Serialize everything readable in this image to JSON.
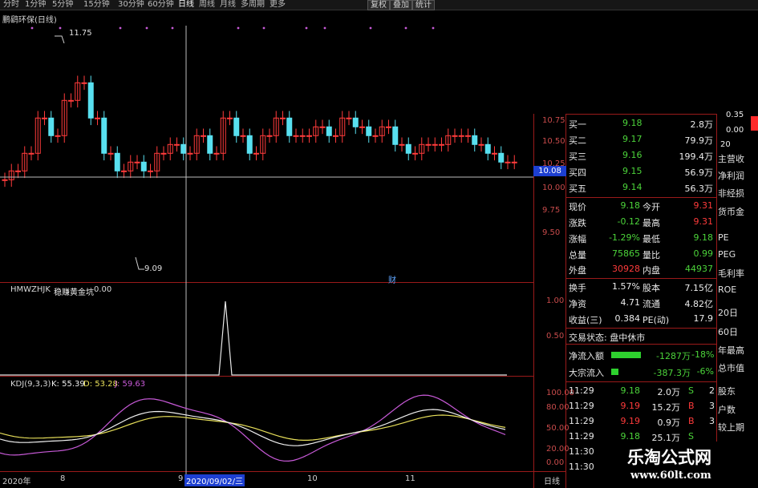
{
  "toolbar": {
    "periods": [
      "分时",
      "1分钟",
      "5分钟",
      "15分钟",
      "30分钟",
      "60分钟",
      "日线",
      "周线",
      "月线",
      "多周期",
      "更多"
    ],
    "buttons": [
      "复权",
      "叠加",
      "统计"
    ]
  },
  "main_chart": {
    "title": "鹏鹞环保(日线)",
    "high_label": "11.75",
    "low_label": "9.09",
    "price_levels": [
      "10.75",
      "10.50",
      "10.25",
      "10.00",
      "9.75",
      "9.50"
    ],
    "current_price": "10.08",
    "fin_marker": "财"
  },
  "indicator1": {
    "name": "HMWZHJK",
    "title": "稳赚黄金坑",
    "value": "0.00",
    "levels": [
      "1.00",
      "0.50"
    ]
  },
  "kdj": {
    "name": "KDJ(9,3,3)",
    "k": "K: 55.39",
    "d": "D: 53.28",
    "j": "J: 59.63",
    "levels": [
      "100.00",
      "80.00",
      "50.00",
      "20.00",
      "0.00"
    ],
    "colors": {
      "k": "#f0f0f0",
      "d": "#e8e05a",
      "j": "#c85ad8"
    }
  },
  "x_axis": {
    "labels": [
      "2020年",
      "8",
      "9",
      "2020/09/02/三",
      "10",
      "11"
    ],
    "period": "日线"
  },
  "top_right": {
    "v1": "0.35",
    "v2": "0.00",
    "v3": "20"
  },
  "order_book": [
    {
      "label": "买一",
      "price": "9.18",
      "vol": "2.8万"
    },
    {
      "label": "买二",
      "price": "9.17",
      "vol": "79.9万"
    },
    {
      "label": "买三",
      "price": "9.16",
      "vol": "199.4万"
    },
    {
      "label": "买四",
      "price": "9.15",
      "vol": "56.9万"
    },
    {
      "label": "买五",
      "price": "9.14",
      "vol": "56.3万"
    }
  ],
  "quote": {
    "row1": {
      "l1": "现价",
      "v1": "9.18",
      "l2": "今开",
      "v2": "9.31"
    },
    "row2": {
      "l1": "涨跌",
      "v1": "-0.12",
      "l2": "最高",
      "v2": "9.31"
    },
    "row3": {
      "l1": "涨幅",
      "v1": "-1.29%",
      "l2": "最低",
      "v2": "9.18"
    },
    "row4": {
      "l1": "总量",
      "v1": "75865",
      "l2": "量比",
      "v2": "0.99"
    },
    "row5": {
      "l1": "外盘",
      "v1": "30928",
      "l2": "内盘",
      "v2": "44937"
    }
  },
  "finance": {
    "row1": {
      "l1": "换手",
      "v1": "1.57%",
      "l2": "股本",
      "v2": "7.15亿"
    },
    "row2": {
      "l1": "净资",
      "v1": "4.71",
      "l2": "流通",
      "v2": "4.82亿"
    },
    "row3": {
      "l1": "收益(三)",
      "v1": "0.384",
      "l2": "PE(动)",
      "v2": "17.9"
    }
  },
  "status": "交易状态: 盘中休市",
  "flows": [
    {
      "label": "净流入额",
      "value": "-1287万",
      "pct": "-18%",
      "bar": 0.85
    },
    {
      "label": "大宗流入",
      "value": "-387.3万",
      "pct": "-6%",
      "bar": 0.2
    }
  ],
  "ticks": [
    {
      "time": "11:29",
      "price": "9.18",
      "vol": "2.0万",
      "side": "S",
      "n": "2"
    },
    {
      "time": "11:29",
      "price": "9.19",
      "vol": "15.2万",
      "side": "B",
      "n": "3"
    },
    {
      "time": "11:29",
      "price": "9.19",
      "vol": "0.9万",
      "side": "B",
      "n": "3"
    },
    {
      "time": "11:29",
      "price": "9.18",
      "vol": "25.1万",
      "side": "S",
      "n": ""
    },
    {
      "time": "11:30",
      "price": "",
      "vol": "",
      "side": "",
      "n": ""
    },
    {
      "time": "11:30",
      "price": "",
      "vol": "",
      "side": "",
      "n": ""
    }
  ],
  "side_menu": [
    "主营收",
    "净利润",
    "非经损",
    "货币金",
    "PE",
    "PEG",
    "毛利率",
    "ROE",
    "20日",
    "60日",
    "年最高",
    "总市值",
    "股东",
    "户数",
    "较上期"
  ],
  "watermark": {
    "title": "乐淘公式网",
    "url": "www.60lt.com"
  }
}
